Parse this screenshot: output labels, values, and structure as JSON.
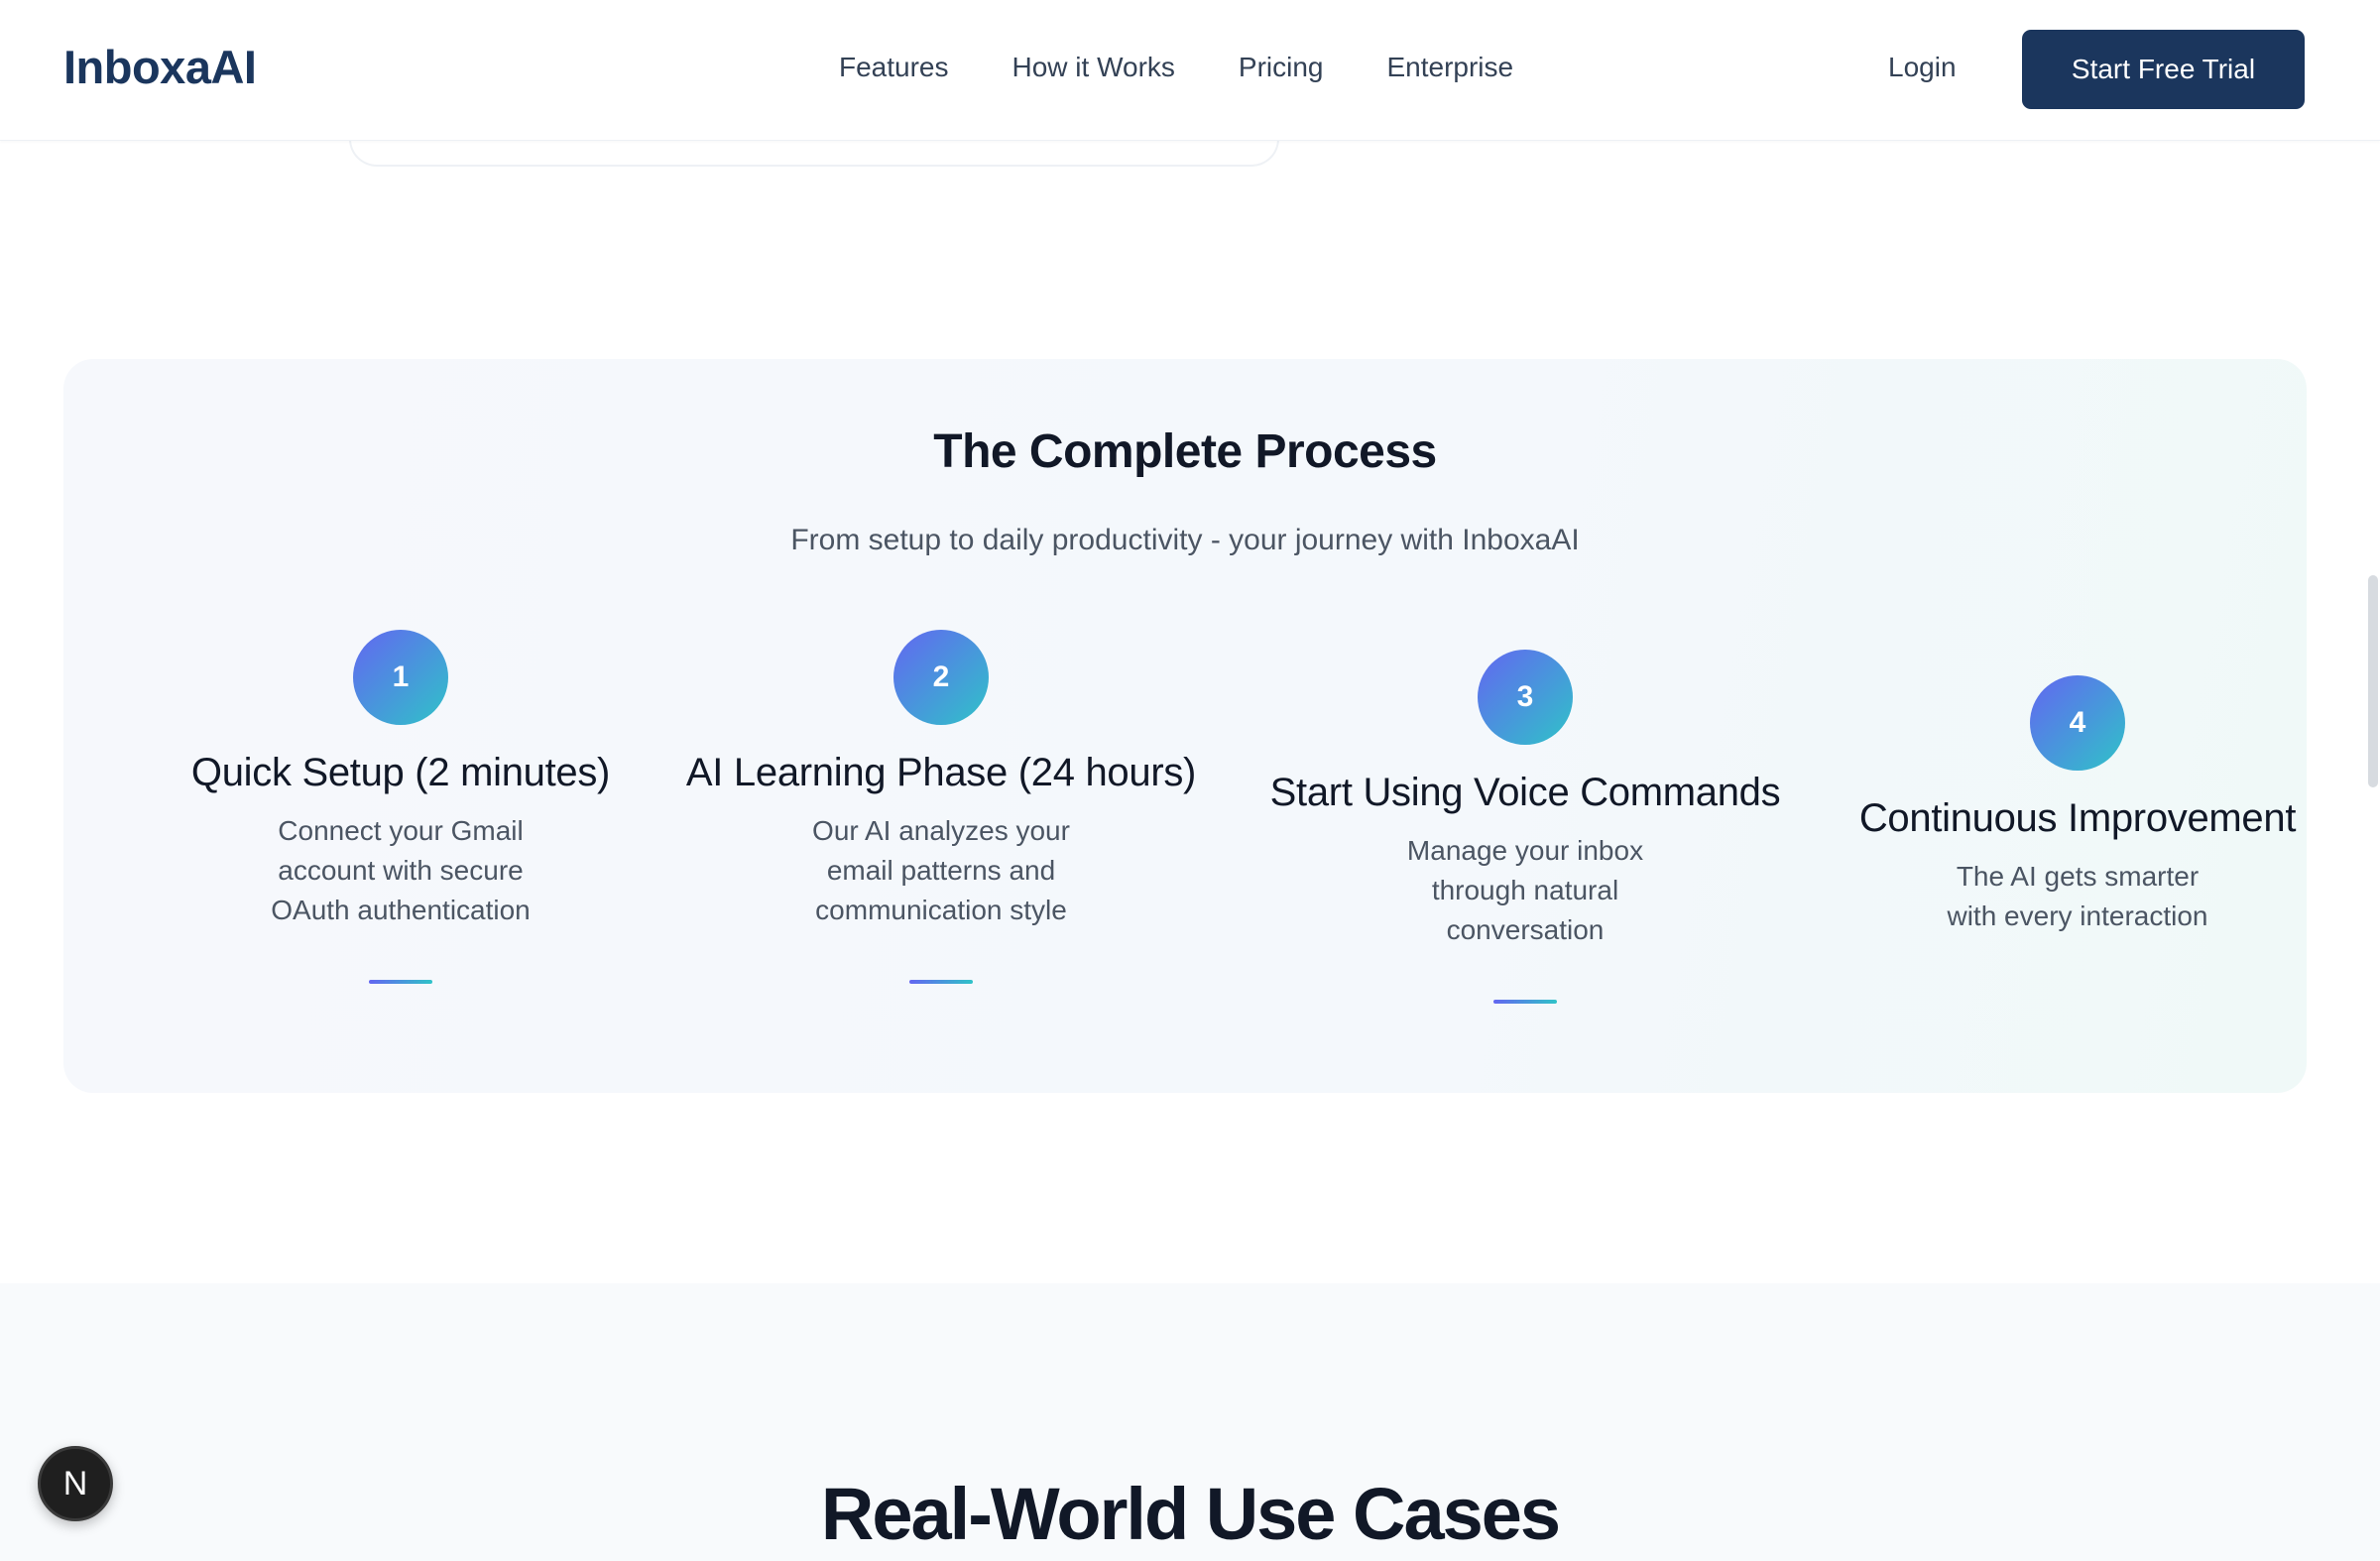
{
  "nav": {
    "logo": "InboxaAI",
    "links": [
      "Features",
      "How it Works",
      "Pricing",
      "Enterprise"
    ],
    "login": "Login",
    "cta": "Start Free Trial"
  },
  "process": {
    "title": "The Complete Process",
    "subtitle": "From setup to daily productivity - your journey with InboxaAI",
    "steps": [
      {
        "number": "1",
        "title": "Quick Setup (2 minutes)",
        "description": "Connect your Gmail account with secure OAuth authentication"
      },
      {
        "number": "2",
        "title": "AI Learning Phase (24 hours)",
        "description": "Our AI analyzes your email patterns and communication style"
      },
      {
        "number": "3",
        "title": "Start Using Voice Commands",
        "description": "Manage your inbox through natural conversation"
      },
      {
        "number": "4",
        "title": "Continuous Improvement",
        "description": "The AI gets smarter with every interaction"
      }
    ]
  },
  "usecases": {
    "title": "Real-World Use Cases"
  },
  "badge": {
    "letter": "N"
  },
  "colors": {
    "brand": "#1b365d",
    "gradient_start": "#6366f1",
    "gradient_end": "#2fc3c8"
  }
}
